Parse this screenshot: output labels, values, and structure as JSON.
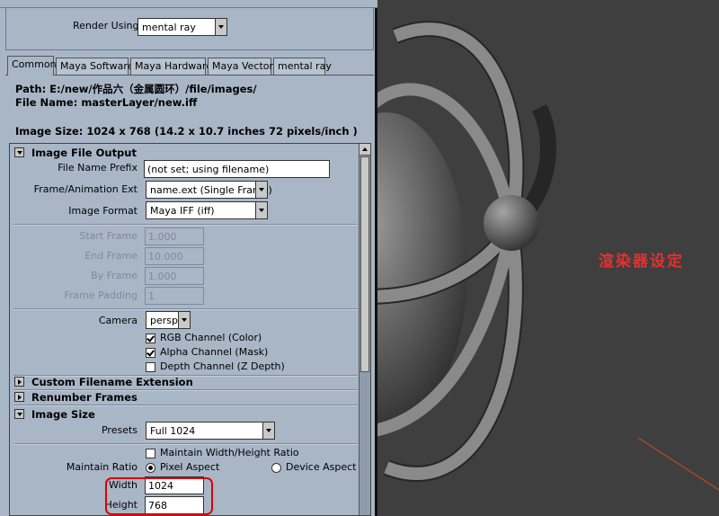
{
  "render_using": {
    "label": "Render Using",
    "value": "mental ray"
  },
  "tabs": [
    {
      "label": "Common",
      "active": true
    },
    {
      "label": "Maya Software"
    },
    {
      "label": "Maya Hardware"
    },
    {
      "label": "Maya Vector"
    },
    {
      "label": "mental ray"
    }
  ],
  "info": {
    "path": "Path:  E:/new/作品六（金属圆环）/file/images/",
    "file_name": "File Name:  masterLayer/new.iff",
    "image_size": "Image Size: 1024 x 768 (14.2 x 10.7 inches 72 pixels/inch )"
  },
  "image_file_output": {
    "title": "Image File Output",
    "file_name_prefix": {
      "label": "File Name Prefix",
      "value": "(not set; using filename)"
    },
    "frame_animation_ext": {
      "label": "Frame/Animation Ext",
      "value": "name.ext (Single Frame)"
    },
    "image_format": {
      "label": "Image Format",
      "value": "Maya IFF (iff)"
    },
    "start_frame": {
      "label": "Start Frame",
      "value": "1.000"
    },
    "end_frame": {
      "label": "End Frame",
      "value": "10.000"
    },
    "by_frame": {
      "label": "By Frame",
      "value": "1.000"
    },
    "frame_padding": {
      "label": "Frame Padding",
      "value": "1"
    },
    "camera": {
      "label": "Camera",
      "value": "persp"
    },
    "rgb_channel": {
      "label": "RGB Channel (Color)",
      "checked": true
    },
    "alpha_channel": {
      "label": "Alpha Channel (Mask)",
      "checked": true
    },
    "depth_channel": {
      "label": "Depth Channel (Z Depth)",
      "checked": false
    }
  },
  "collapsed_sections": {
    "custom_filename_extension": "Custom Filename Extension",
    "renumber_frames": "Renumber Frames"
  },
  "image_size": {
    "title": "Image Size",
    "presets": {
      "label": "Presets",
      "value": "Full 1024"
    },
    "maintain_wh_ratio": {
      "label": "Maintain Width/Height Ratio",
      "checked": false
    },
    "maintain_ratio": {
      "label": "Maintain Ratio",
      "pixel_aspect": "Pixel Aspect",
      "device_aspect": "Device Aspect",
      "selected": "Pixel Aspect"
    },
    "width": {
      "label": "Width",
      "value": "1024"
    },
    "height": {
      "label": "Height",
      "value": "768"
    }
  },
  "annotation": {
    "text": "渲染器设定",
    "color": "#e53030"
  },
  "colors": {
    "panel_bg": "#a9b6c6",
    "viewport_bg": "#3f3f3f",
    "highlight": "#dd0000"
  }
}
